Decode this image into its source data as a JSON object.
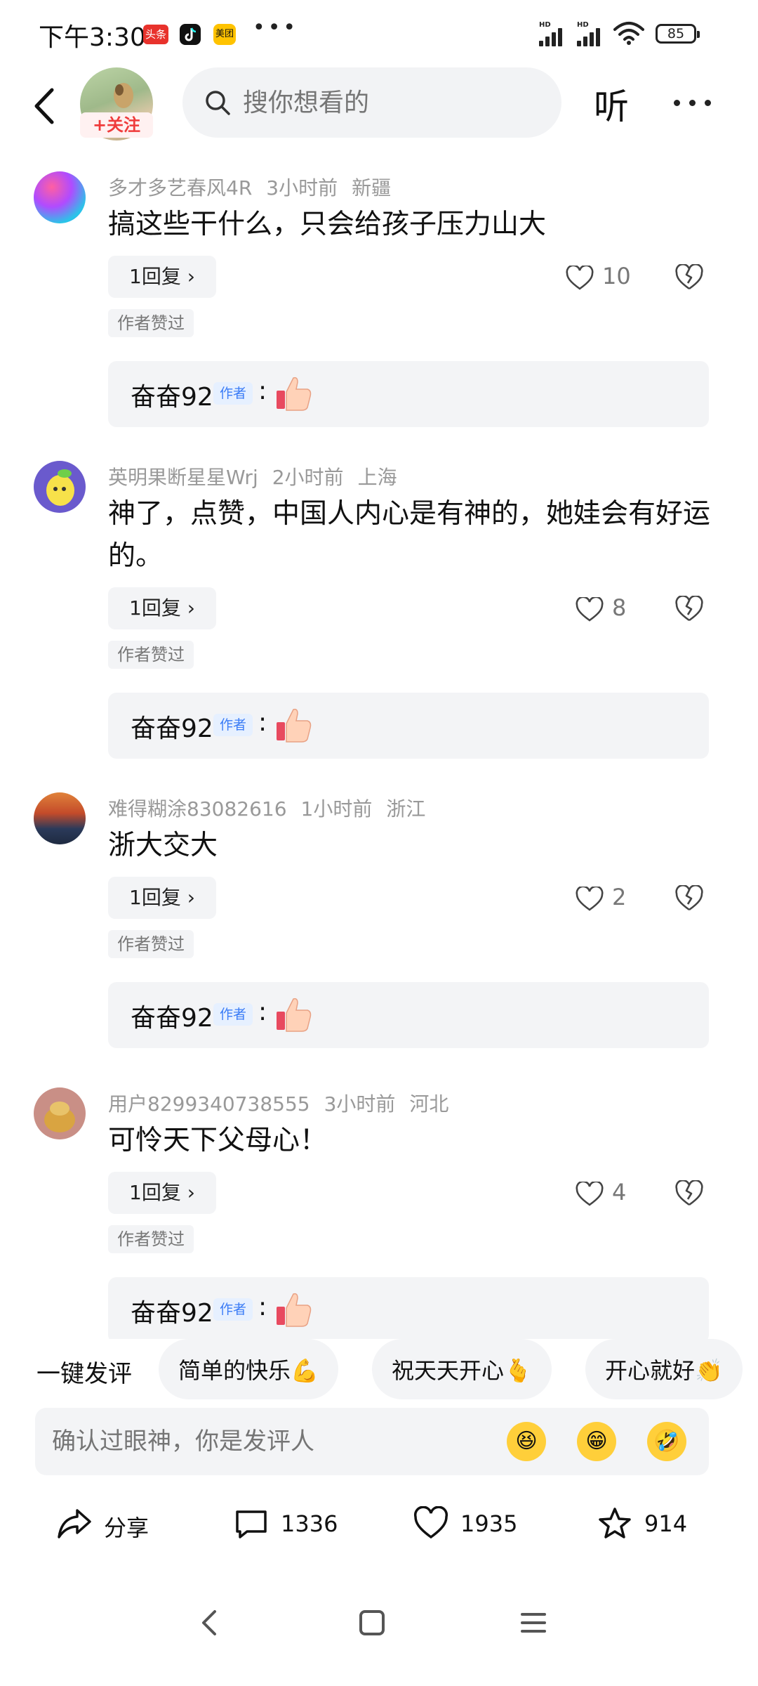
{
  "status": {
    "time": "下午3:30",
    "badge_toutiao": "头条",
    "badge_meituan": "美团",
    "dots": "•••",
    "battery": "85"
  },
  "header": {
    "follow": "+关注",
    "search_placeholder": "搜你想看的",
    "listen": "听"
  },
  "comments": [
    {
      "user": "多才多艺春风4R",
      "time": "3小时前",
      "location": "新疆",
      "text": "搞这些干什么，只会给孩子压力山大",
      "reply": "1回复 ›",
      "likes": "10",
      "author_liked": "作者赞过",
      "author_name": "奋奋92",
      "author_tag": "作者",
      "colon": ":"
    },
    {
      "user": "英明果断星星Wrj",
      "time": "2小时前",
      "location": "上海",
      "text": "神了，点赞，中国人内心是有神的，她娃会有好运的。",
      "reply": "1回复 ›",
      "likes": "8",
      "author_liked": "作者赞过",
      "author_name": "奋奋92",
      "author_tag": "作者",
      "colon": ":"
    },
    {
      "user": "难得糊涂83082616",
      "time": "1小时前",
      "location": "浙江",
      "text": "浙大交大",
      "reply": "1回复 ›",
      "likes": "2",
      "author_liked": "作者赞过",
      "author_name": "奋奋92",
      "author_tag": "作者",
      "colon": ":"
    },
    {
      "user": "用户8299340738555",
      "time": "3小时前",
      "location": "河北",
      "text": "可怜天下父母心！",
      "reply": "1回复 ›",
      "likes": "4",
      "author_liked": "作者赞过",
      "author_name": "奋奋92",
      "author_tag": "作者",
      "colon": ":"
    }
  ],
  "quick": {
    "label": "一键发评",
    "chips": [
      "简单的快乐💪",
      "祝天天开心🫰",
      "开心就好👏"
    ]
  },
  "input": {
    "placeholder": "确认过眼神，你是发评人",
    "emojis": [
      "😆",
      "😁",
      "🤣"
    ]
  },
  "bottom": {
    "share": "分享",
    "comments": "1336",
    "likes": "1935",
    "favorites": "914"
  },
  "colors": {
    "accent_red": "#ef3b3b",
    "author_tag_blue": "#3b7cf6"
  }
}
